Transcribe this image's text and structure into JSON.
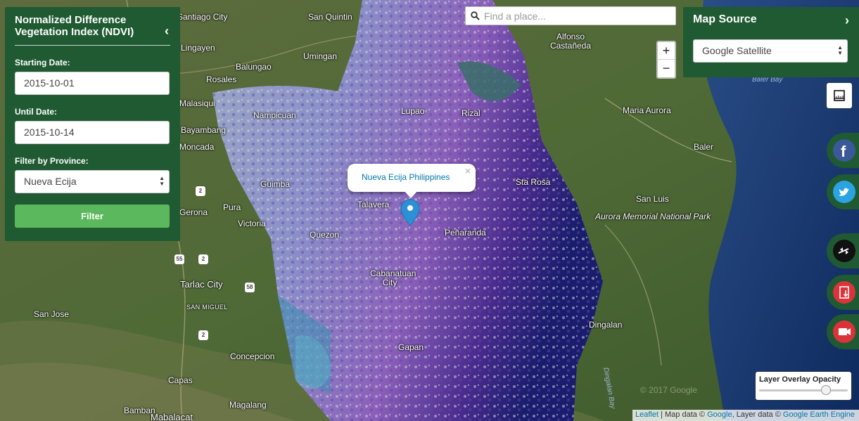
{
  "ndvi_panel": {
    "title": "Normalized Difference Vegetation Index (NDVI)",
    "starting_label": "Starting Date:",
    "starting_value": "2015-10-01",
    "until_label": "Until Date:",
    "until_value": "2015-10-14",
    "province_label": "Filter by Province:",
    "province_value": "Nueva Ecija",
    "filter_label": "Filter"
  },
  "search": {
    "placeholder": "Find a place..."
  },
  "zoom": {
    "in_label": "+",
    "out_label": "−"
  },
  "source_panel": {
    "title": "Map Source",
    "selected": "Google Satellite"
  },
  "popup": {
    "text": "Nueva Ecija Philippines",
    "close": "×"
  },
  "opacity": {
    "label": "Layer Overlay Opacity",
    "value": 0.75
  },
  "attribution": {
    "leaflet": "Leaflet",
    "sep1": " | Map data © ",
    "google": "Google",
    "sep2": ", Layer data © ",
    "gee": "Google Earth Engine"
  },
  "watermark": "© 2017 Google",
  "side_buttons": [
    "facebook-icon",
    "twitter-icon",
    "compare-icon",
    "export-icon",
    "video-icon"
  ],
  "colors": {
    "panel_green": "#1f5a32",
    "filter_green": "#5cb85c",
    "link_blue": "#0078a8"
  },
  "map_labels": {
    "santiago_city": "Santiago City",
    "san_quintin": "San Quintin",
    "alfonso_castaneda": "Alfonso Castañeda",
    "umingan": "Umingan",
    "rosales": "Rosales",
    "balungao": "Balungao",
    "bayambang": "Bayambang",
    "lupao": "Lupao",
    "rizal": "Rizal",
    "maria_aurora": "Maria Aurora",
    "baler": "Baler",
    "baler_bay": "Baler Bay",
    "moncada": "Moncada",
    "gerona": "Gerona",
    "pura": "Pura",
    "victoria": "Victoria",
    "talavera": "Talavera",
    "quezon": "Quezon",
    "san_luis": "San Luis",
    "aurora_park": "Aurora Memorial National Park",
    "tarlac_city": "Tarlac City",
    "san_miguel": "SAN MIGUEL",
    "san_jose": "San Jose",
    "cabanatuan": "Cabanatuan City",
    "concepcion": "Concepcion",
    "capas": "Capas",
    "dingalan": "Dingalan",
    "dingalan_bay": "Dingalan Bay",
    "magalang": "Magalang",
    "bamban": "Bamban",
    "mabalacat": "Mabalacat",
    "lingayen": "Lingayen",
    "malasiqui": "Malasiqui",
    "nampicuan": "Nampicuan",
    "guimba": "Guimba",
    "sta_rosa": "Sta Rosa",
    "penaranda": "Peñaranda",
    "gapan": "Gapan"
  }
}
